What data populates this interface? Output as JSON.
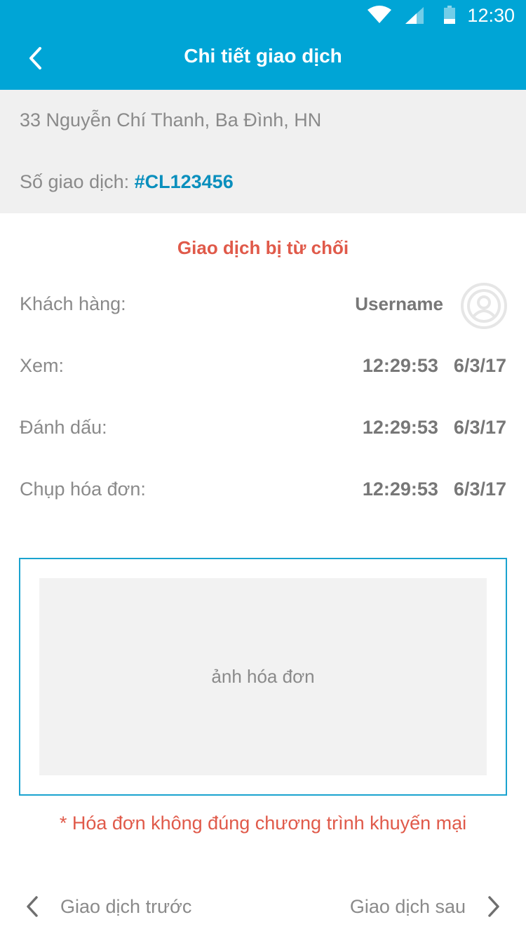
{
  "status_bar": {
    "time": "12:30",
    "battery_level": 0.3,
    "icons": [
      "wifi-icon",
      "signal-icon",
      "battery-icon"
    ]
  },
  "header": {
    "title": "Chi tiết giao dịch",
    "back_icon": "chevron-left-icon",
    "background": "#00a5d6"
  },
  "info": {
    "address": "33 Nguyễn Chí Thanh, Ba Đình, HN",
    "txn_label": "Số giao dịch: ",
    "txn_id": "#CL123456",
    "txn_id_color": "#0a8fbd"
  },
  "status": {
    "text": "Giao dịch bị từ chối",
    "color": "#e05a4a"
  },
  "details": {
    "customer_label": "Khách hàng:",
    "customer_name": "Username",
    "avatar_icon": "user-avatar-icon",
    "rows": [
      {
        "label": "Xem:",
        "time": "12:29:53",
        "date": "6/3/17"
      },
      {
        "label": "Đánh dấu:",
        "time": "12:29:53",
        "date": "6/3/17"
      },
      {
        "label": "Chụp hóa đơn:",
        "time": "12:29:53",
        "date": "6/3/17"
      }
    ]
  },
  "receipt": {
    "placeholder": "ảnh hóa đơn",
    "border_color": "#1aa3cf"
  },
  "error_note": "* Hóa đơn không đúng chương trình khuyến mại",
  "navigation": {
    "prev_label": "Giao dịch trước",
    "next_label": "Giao dịch sau",
    "prev_icon": "chevron-left-icon",
    "next_icon": "chevron-right-icon"
  }
}
